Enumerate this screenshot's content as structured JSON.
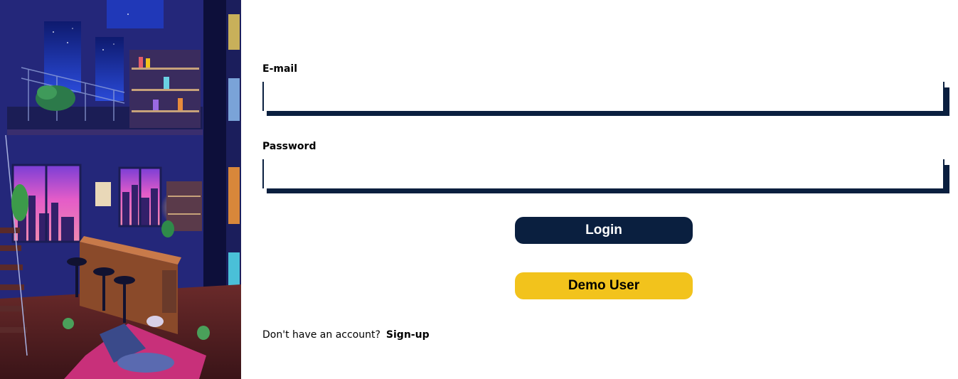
{
  "illustration": {
    "alt": "Cozy loft room at night with city view",
    "palette": {
      "night_sky": "#1a2a9c",
      "sunset_pink": "#e45cc8",
      "wall": "#2c2f8a",
      "floor": "#5a2628",
      "rug": "#c8307a",
      "lamp_glow": "#ffd27a"
    }
  },
  "form": {
    "email_label": "E-mail",
    "email_value": "",
    "email_placeholder": "",
    "password_label": "Password",
    "password_value": "",
    "password_placeholder": "",
    "login_label": "Login",
    "demo_label": "Demo User",
    "signup_prompt": "Don't have an account?",
    "signup_link": "Sign-up"
  },
  "colors": {
    "navy": "#0a1f3f",
    "yellow": "#f2c31c",
    "background": "#ffffff"
  }
}
